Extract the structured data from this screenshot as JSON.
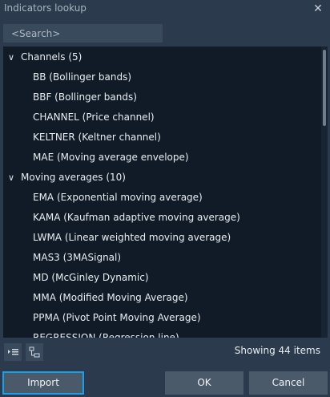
{
  "window": {
    "title": "Indicators lookup"
  },
  "search": {
    "placeholder": "<Search>"
  },
  "list": {
    "rows": [
      {
        "type": "group",
        "label": "Channels  (5)"
      },
      {
        "type": "item",
        "label": "BB (Bollinger bands)"
      },
      {
        "type": "item",
        "label": "BBF (Bollinger bands)"
      },
      {
        "type": "item",
        "label": "CHANNEL (Price channel)"
      },
      {
        "type": "item",
        "label": "KELTNER (Keltner channel)"
      },
      {
        "type": "item",
        "label": "MAE (Moving average envelope)"
      },
      {
        "type": "group",
        "label": "Moving averages  (10)"
      },
      {
        "type": "item",
        "label": "EMA (Exponential moving average)"
      },
      {
        "type": "item",
        "label": "KAMA (Kaufman adaptive moving average)"
      },
      {
        "type": "item",
        "label": "LWMA (Linear weighted moving average)"
      },
      {
        "type": "item",
        "label": "MAS3 (3MASignal)"
      },
      {
        "type": "item",
        "label": "MD (McGinley Dynamic)"
      },
      {
        "type": "item",
        "label": "MMA (Modified Moving Average)"
      },
      {
        "type": "item",
        "label": "PPMA (Pivot Point Moving Average)"
      },
      {
        "type": "item",
        "label": "REGRESSION (Regression line)"
      }
    ]
  },
  "footer": {
    "count_text": "Showing 44 items"
  },
  "buttons": {
    "import": "Import",
    "ok": "OK",
    "cancel": "Cancel"
  },
  "colors": {
    "background": "#2b3a4c",
    "list_bg": "#111b27",
    "accent": "#1aa0e6",
    "button": "#4b5a6b"
  }
}
